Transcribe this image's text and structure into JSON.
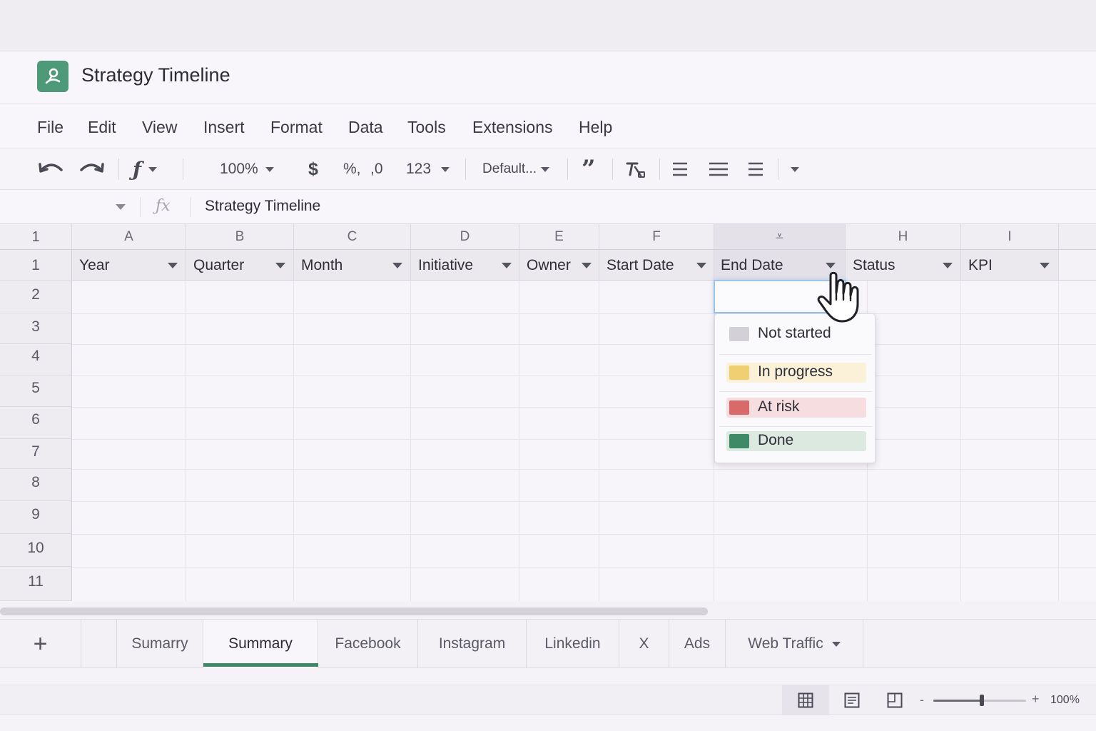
{
  "app": {
    "title": "Strategy Timeline",
    "logo_icon": "sheets-logo-icon",
    "accent": "#4e9a78"
  },
  "menu": [
    "File",
    "Edit",
    "View",
    "Insert",
    "Format",
    "Data",
    "Tools",
    "Extensions",
    "Help"
  ],
  "toolbar": {
    "undo_icon": "undo-icon",
    "redo_icon": "redo-icon",
    "function_label": "ƒ",
    "zoom": "100%",
    "currency": "$",
    "percent": "%,",
    "decimal": ",0",
    "number_format": "123",
    "font": "Default...",
    "quote": "”",
    "clear_format_icon": "clear-formatting-icon",
    "align_icons": [
      "align-left-icon",
      "align-center-icon",
      "align-justify-icon"
    ],
    "more_icon": "chevron-down-icon"
  },
  "formula_bar": {
    "fx": "ƒx",
    "value": "Strategy Timeline"
  },
  "grid": {
    "corner": "1",
    "columns": [
      "A",
      "B",
      "C",
      "D",
      "E",
      "F",
      "⩡",
      "H",
      "I"
    ],
    "selected_column": "G",
    "headers": [
      "Year",
      "Quarter",
      "Month",
      "Initiative",
      "Owner",
      "Start Date",
      "End Date",
      "Status",
      "KPI"
    ],
    "row_numbers": [
      "1",
      "2",
      "3",
      "4",
      "5",
      "6",
      "7",
      "8",
      "9",
      "10",
      "11"
    ]
  },
  "status_dropdown": {
    "items": [
      {
        "label": "Not started",
        "color": "#d3d0d8",
        "bg": ""
      },
      {
        "label": "In progress",
        "color": "#f0cf73",
        "bg": "#faf1d8"
      },
      {
        "label": "At risk",
        "color": "#d96a6a",
        "bg": "#f6dde0"
      },
      {
        "label": "Done",
        "color": "#3f8a66",
        "bg": "#dbe9e1"
      }
    ]
  },
  "sheets": {
    "add_label": "+",
    "tabs": [
      "Sumarry",
      "Summary",
      "Facebook",
      "Instagram",
      "Linkedin",
      "X",
      "Ads",
      "Web Traffic"
    ],
    "active": "Summary"
  },
  "statusbar": {
    "zoom_label": "100%",
    "zoom_minus": "-",
    "zoom_plus": "+",
    "zoom_level": 0.52,
    "view_icons": [
      "grid-view-icon",
      "page-layout-icon",
      "page-break-icon"
    ]
  }
}
